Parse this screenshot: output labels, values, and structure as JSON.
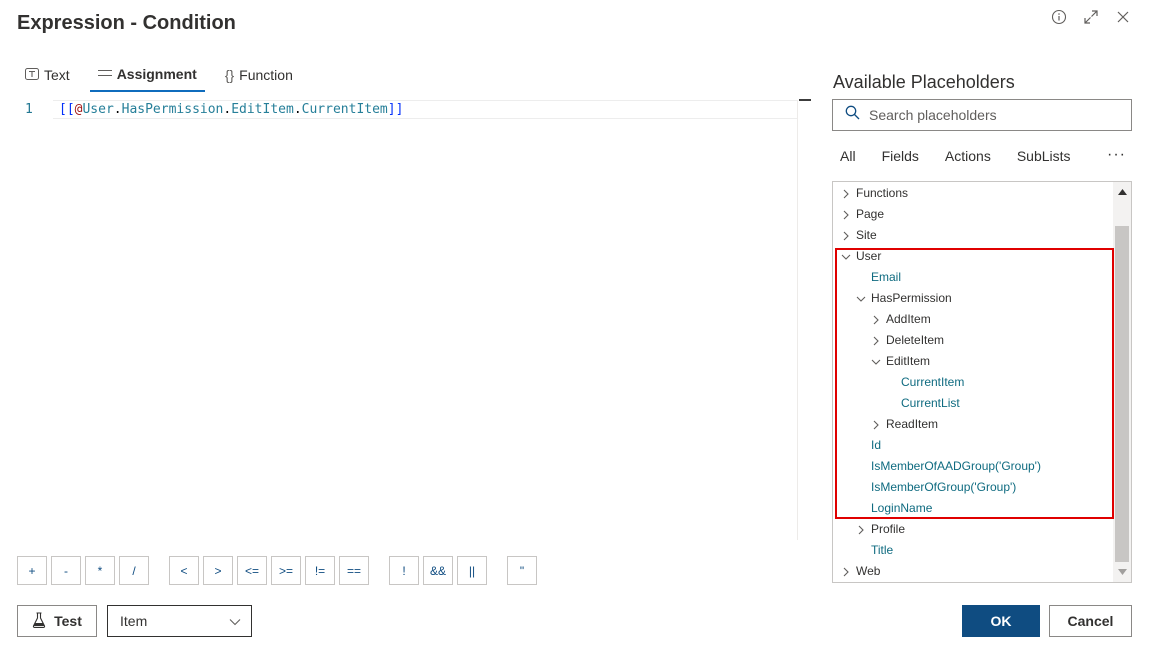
{
  "dialog": {
    "title": "Expression - Condition"
  },
  "tabs": [
    {
      "label": "Text",
      "icon": "text-box-icon"
    },
    {
      "label": "Assignment",
      "icon": "equals-icon"
    },
    {
      "label": "Function",
      "icon": "braces-icon"
    }
  ],
  "editor": {
    "line_number": "1",
    "tokens": {
      "open": "[[",
      "at": "@",
      "user": "User",
      "dot1": ".",
      "perm": "HasPermission",
      "dot2": ".",
      "edit": "EditItem",
      "dot3": ".",
      "current": "CurrentItem",
      "close": "]]"
    }
  },
  "operators": [
    "+",
    "-",
    "*",
    "/",
    "<",
    ">",
    "<=",
    ">=",
    "!=",
    "==",
    "!",
    "&&",
    "||",
    "\""
  ],
  "footer": {
    "test_label": "Test",
    "select_value": "Item",
    "ok_label": "OK",
    "cancel_label": "Cancel"
  },
  "placeholders": {
    "title": "Available Placeholders",
    "search_placeholder": "Search placeholders",
    "filters": [
      "All",
      "Fields",
      "Actions",
      "SubLists"
    ],
    "more": "···",
    "tree": [
      {
        "label": "Functions",
        "level": 0,
        "state": "collapsed"
      },
      {
        "label": "Page",
        "level": 0,
        "state": "collapsed"
      },
      {
        "label": "Site",
        "level": 0,
        "state": "collapsed"
      },
      {
        "label": "User",
        "level": 0,
        "state": "expanded"
      },
      {
        "label": "Email",
        "level": 1,
        "state": "leaf"
      },
      {
        "label": "HasPermission",
        "level": 1,
        "state": "expanded"
      },
      {
        "label": "AddItem",
        "level": 2,
        "state": "collapsed"
      },
      {
        "label": "DeleteItem",
        "level": 2,
        "state": "collapsed"
      },
      {
        "label": "EditItem",
        "level": 2,
        "state": "expanded"
      },
      {
        "label": "CurrentItem",
        "level": 3,
        "state": "leaf"
      },
      {
        "label": "CurrentList",
        "level": 3,
        "state": "leaf"
      },
      {
        "label": "ReadItem",
        "level": 2,
        "state": "collapsed"
      },
      {
        "label": "Id",
        "level": 1,
        "state": "leaf"
      },
      {
        "label": "IsMemberOfAADGroup('Group')",
        "level": 1,
        "state": "leaf"
      },
      {
        "label": "IsMemberOfGroup('Group')",
        "level": 1,
        "state": "leaf"
      },
      {
        "label": "LoginName",
        "level": 1,
        "state": "leaf"
      },
      {
        "label": "Profile",
        "level": 1,
        "state": "collapsed"
      },
      {
        "label": "Title",
        "level": 1,
        "state": "leaf"
      },
      {
        "label": "Web",
        "level": 0,
        "state": "collapsed"
      }
    ]
  },
  "colors": {
    "primary": "#0f4c81",
    "leaf_text": "#0f6b80",
    "highlight": "#e00000"
  }
}
